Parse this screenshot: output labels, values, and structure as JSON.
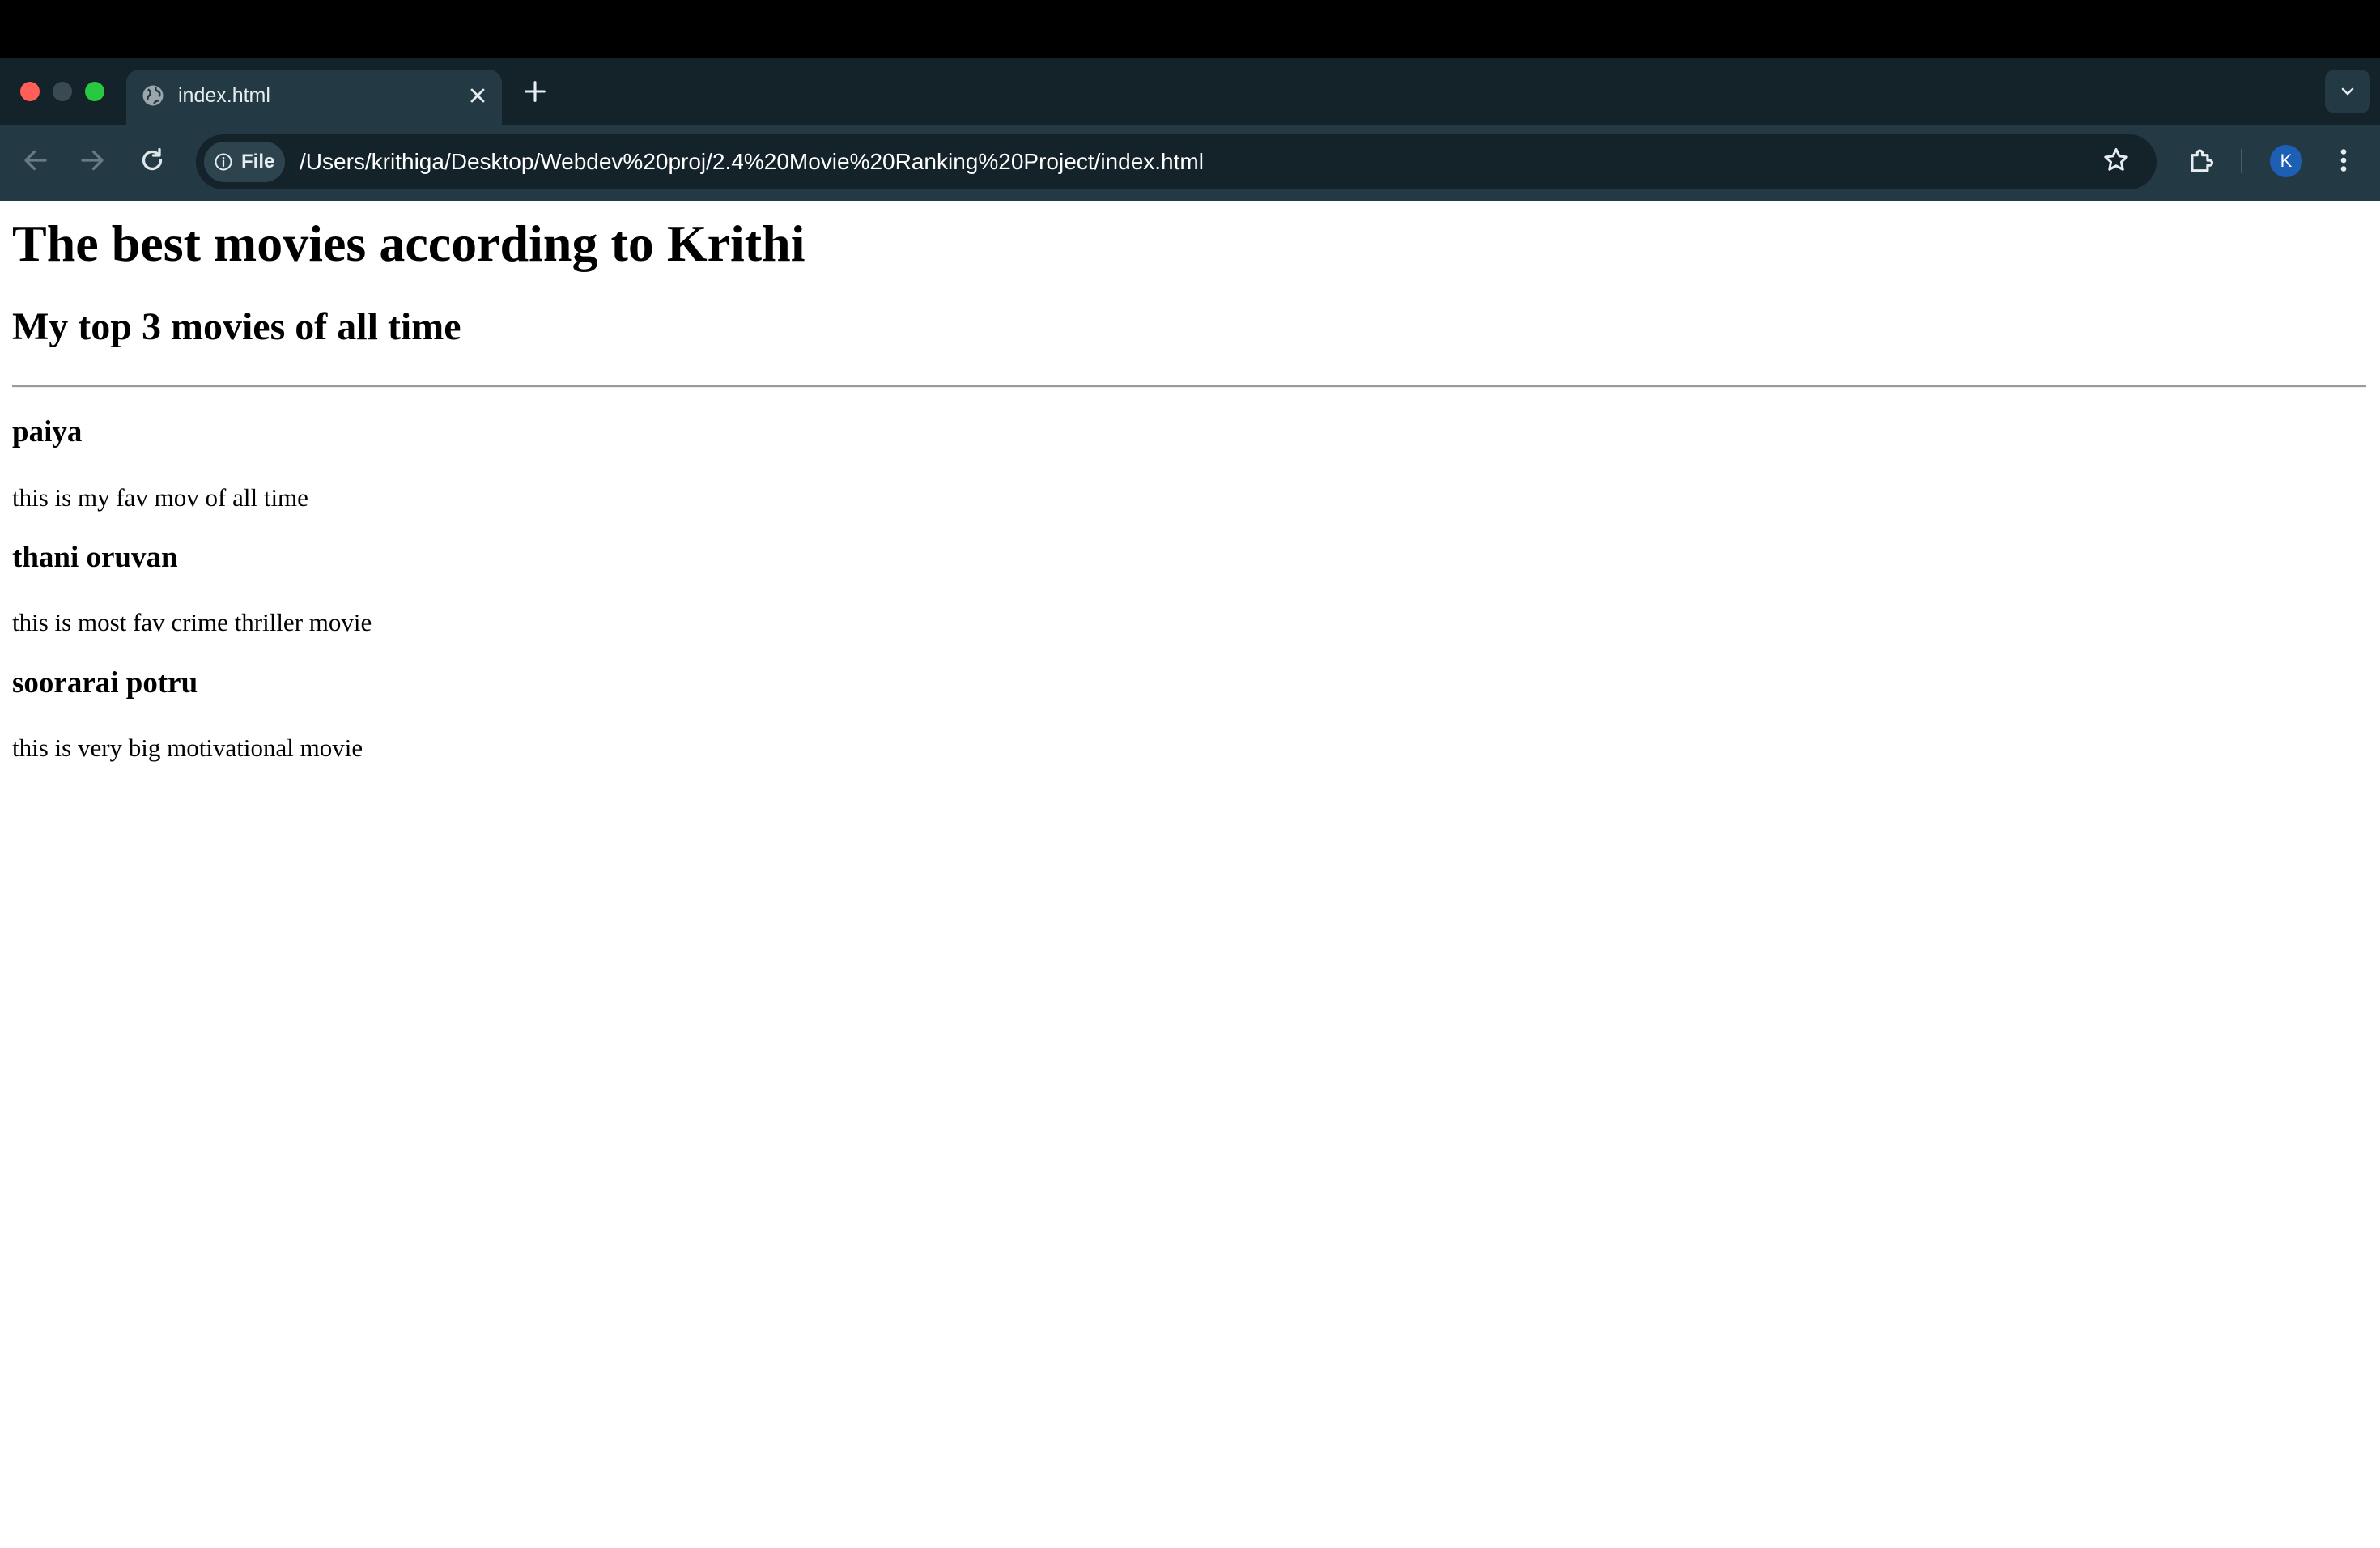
{
  "browser": {
    "tab": {
      "title": "index.html"
    },
    "address_bar": {
      "scheme_chip": "File",
      "url": "/Users/krithiga/Desktop/Webdev%20proj/2.4%20Movie%20Ranking%20Project/index.html"
    },
    "profile": {
      "initial": "K"
    },
    "icons": {
      "tab_favicon": "globe-icon",
      "tab_close": "close-icon",
      "new_tab": "plus-icon",
      "tab_search": "chevron-down-icon",
      "back": "arrow-left-icon",
      "forward": "arrow-right-icon",
      "reload": "reload-icon",
      "site_info": "info-icon",
      "bookmark": "star-icon",
      "extensions": "puzzle-icon",
      "menu": "kebab-icon"
    },
    "colors": {
      "traffic_close": "#ff5f57",
      "traffic_minimize": "#3a4a52",
      "traffic_zoom": "#28c840",
      "chrome_dark": "#14222a",
      "chrome_toolbar": "#233a44",
      "avatar": "#1c5fb5"
    }
  },
  "page": {
    "title": "The best movies according to Krithi",
    "subtitle": "My top 3 movies of all time",
    "movies": [
      {
        "name": "paiya",
        "description": "this is my fav mov of all time"
      },
      {
        "name": "thani oruvan",
        "description": "this is most fav crime thriller movie"
      },
      {
        "name": "soorarai potru",
        "description": "this is very big motivational movie"
      }
    ]
  }
}
